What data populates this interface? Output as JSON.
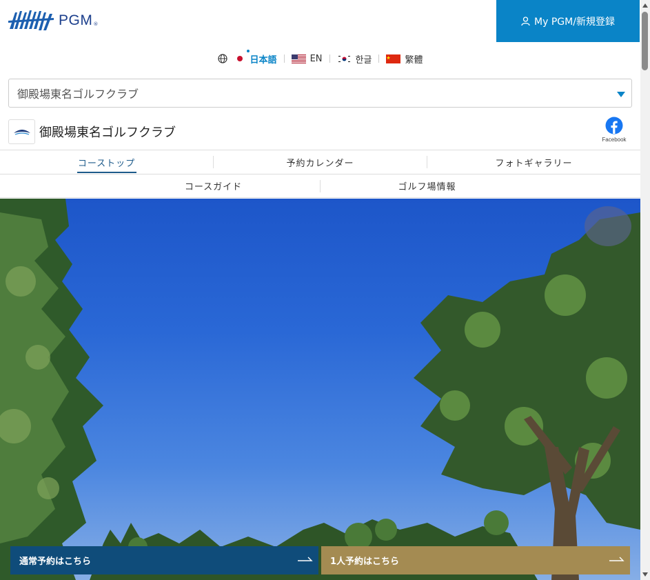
{
  "brand": {
    "name": "PGM",
    "reg": "®"
  },
  "header": {
    "mypgm_label": "My PGM/新規登録"
  },
  "languages": [
    {
      "label": "日本語",
      "active": true
    },
    {
      "label": "EN"
    },
    {
      "label": "한글"
    },
    {
      "label": "繁體"
    }
  ],
  "course_select": {
    "value": "御殿場東名ゴルフクラブ"
  },
  "course": {
    "name": "御殿場東名ゴルフクラブ",
    "facebook_label": "Facebook"
  },
  "tabs": {
    "row1": [
      "コーストップ",
      "予約カレンダー",
      "フォトギャラリー"
    ],
    "row2": [
      "コースガイド",
      "ゴルフ場情報"
    ]
  },
  "reserve": {
    "normal_label": "通常予約はこちら",
    "solo_label": "1人予約はこちら"
  },
  "colors": {
    "primary": "#0a84c7",
    "normal_reserve": "#0f4c7a",
    "solo_reserve": "#a48b52"
  }
}
